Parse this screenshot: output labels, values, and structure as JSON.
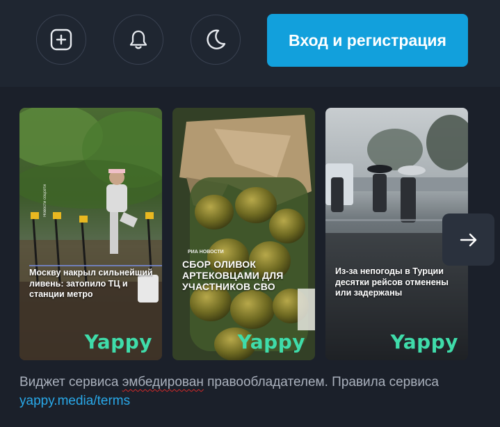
{
  "header": {
    "login_label": "Вход и регистрация",
    "icons": [
      "add-post-icon",
      "bell-icon",
      "moon-icon"
    ]
  },
  "cards": [
    {
      "caption": "Москву накрыл сильнейший ливень: затопило ТЦ и станции метро",
      "vertical_tag": "Новости соцсети",
      "brand": "Yappy"
    },
    {
      "source": "РИА НОВОСТИ",
      "caption": "СБОР ОЛИВОК АРТЕКОВЦАМИ ДЛЯ УЧАСТНИКОВ СВО",
      "brand": "Yappy"
    },
    {
      "caption": "Из-за непогоды в Турции десятки рейсов отменены или задержаны",
      "brand": "Yappy"
    }
  ],
  "footer": {
    "text_before": "Виджет сервиса ",
    "underlined_word": "эмбедирован",
    "text_after": " правообладателем. Правила сервиса ",
    "link_text": "yappy.media/terms"
  },
  "colors": {
    "accent": "#12a0dc",
    "brand_green": "#3fdcaa",
    "link": "#29a8e8",
    "background": "#1b202a"
  }
}
